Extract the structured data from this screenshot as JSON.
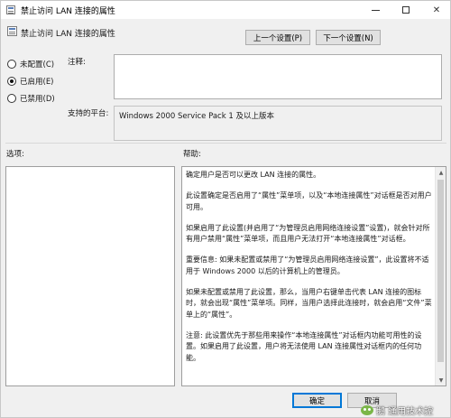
{
  "window": {
    "title": "禁止访问 LAN 连接的属性",
    "controls": [
      "minimize",
      "maximize",
      "close"
    ]
  },
  "header": {
    "title": "禁止访问 LAN 连接的属性",
    "prev_button": "上一个设置(P)",
    "next_button": "下一个设置(N)"
  },
  "state": {
    "options": [
      {
        "label": "未配置(C)",
        "checked": false
      },
      {
        "label": "已启用(E)",
        "checked": true
      },
      {
        "label": "已禁用(D)",
        "checked": false
      }
    ]
  },
  "comment": {
    "label": "注释:",
    "value": ""
  },
  "platform": {
    "label": "支持的平台:",
    "value": "Windows 2000 Service Pack 1 及以上版本"
  },
  "sections": {
    "options_label": "选项:",
    "help_label": "帮助:"
  },
  "help": {
    "paragraphs": [
      "确定用户是否可以更改 LAN 连接的属性。",
      "此设置确定是否启用了“属性”菜单项，以及“本地连接属性”对话框是否对用户可用。",
      "如果启用了此设置(并启用了“为管理员启用网络连接设置”设置)，就会针对所有用户禁用“属性”菜单项，而且用户无法打开“本地连接属性”对话框。",
      "重要信息: 如果未配置或禁用了“为管理员启用网络连接设置”，此设置将不适用于 Windows 2000 以后的计算机上的管理员。",
      "如果未配置或禁用了此设置，那么，当用户右键单击代表 LAN 连接的图标时，就会出现“属性”菜单项。同样，当用户选择此连接时，就会启用“文件”菜单上的“属性”。",
      "注意: 此设置优先于那些用来操作“本地连接属性”对话框内功能可用性的设置。如果启用了此设置，用户将无法使用 LAN 连接属性对话框内的任何功能。"
    ]
  },
  "footer": {
    "ok_button": "确定",
    "cancel_button": "取消"
  },
  "watermark": {
    "text": "鹅 通用技术控"
  },
  "icons": {
    "app": "policy-setting-icon",
    "scroll_up": "scroll-up-arrow-icon",
    "scroll_down": "scroll-down-arrow-icon"
  },
  "colors": {
    "dialog_bg": "#f0f0f0",
    "default_button_border": "#0078d7"
  }
}
